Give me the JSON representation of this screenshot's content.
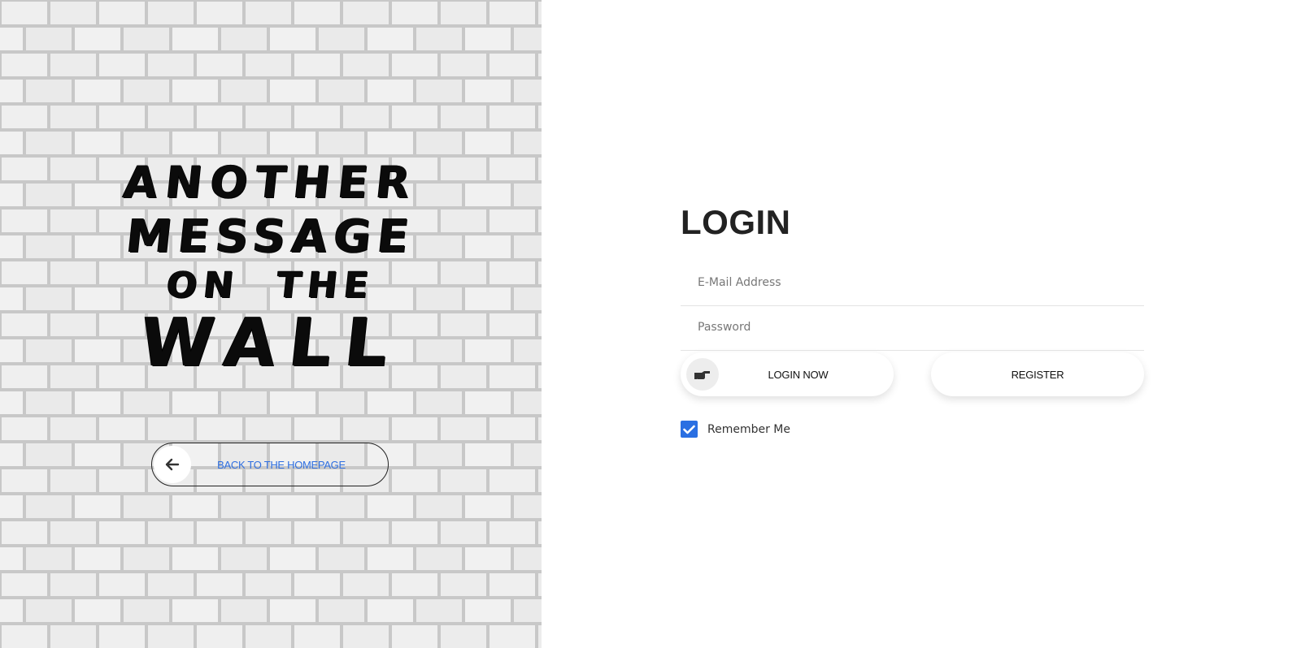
{
  "wall": {
    "message_lines": [
      "ANOTHER",
      "MESSAGE",
      "ON THE",
      "WALL"
    ],
    "back_button": {
      "label": "BACK TO THE HOMEPAGE",
      "icon": "arrow-left-icon"
    }
  },
  "login": {
    "title": "LOGIN",
    "email_placeholder": "E-Mail Address",
    "password_placeholder": "Password",
    "login_button": {
      "label": "LOGIN NOW",
      "icon": "pointing-hand-icon"
    },
    "register_button_label": "REGISTER",
    "remember": {
      "label": "Remember Me",
      "checked": true
    }
  },
  "colors": {
    "accent_blue": "#2a6fe2",
    "link_blue": "#2f6fe0",
    "title": "#222222",
    "wall": "#e9e9e9"
  }
}
